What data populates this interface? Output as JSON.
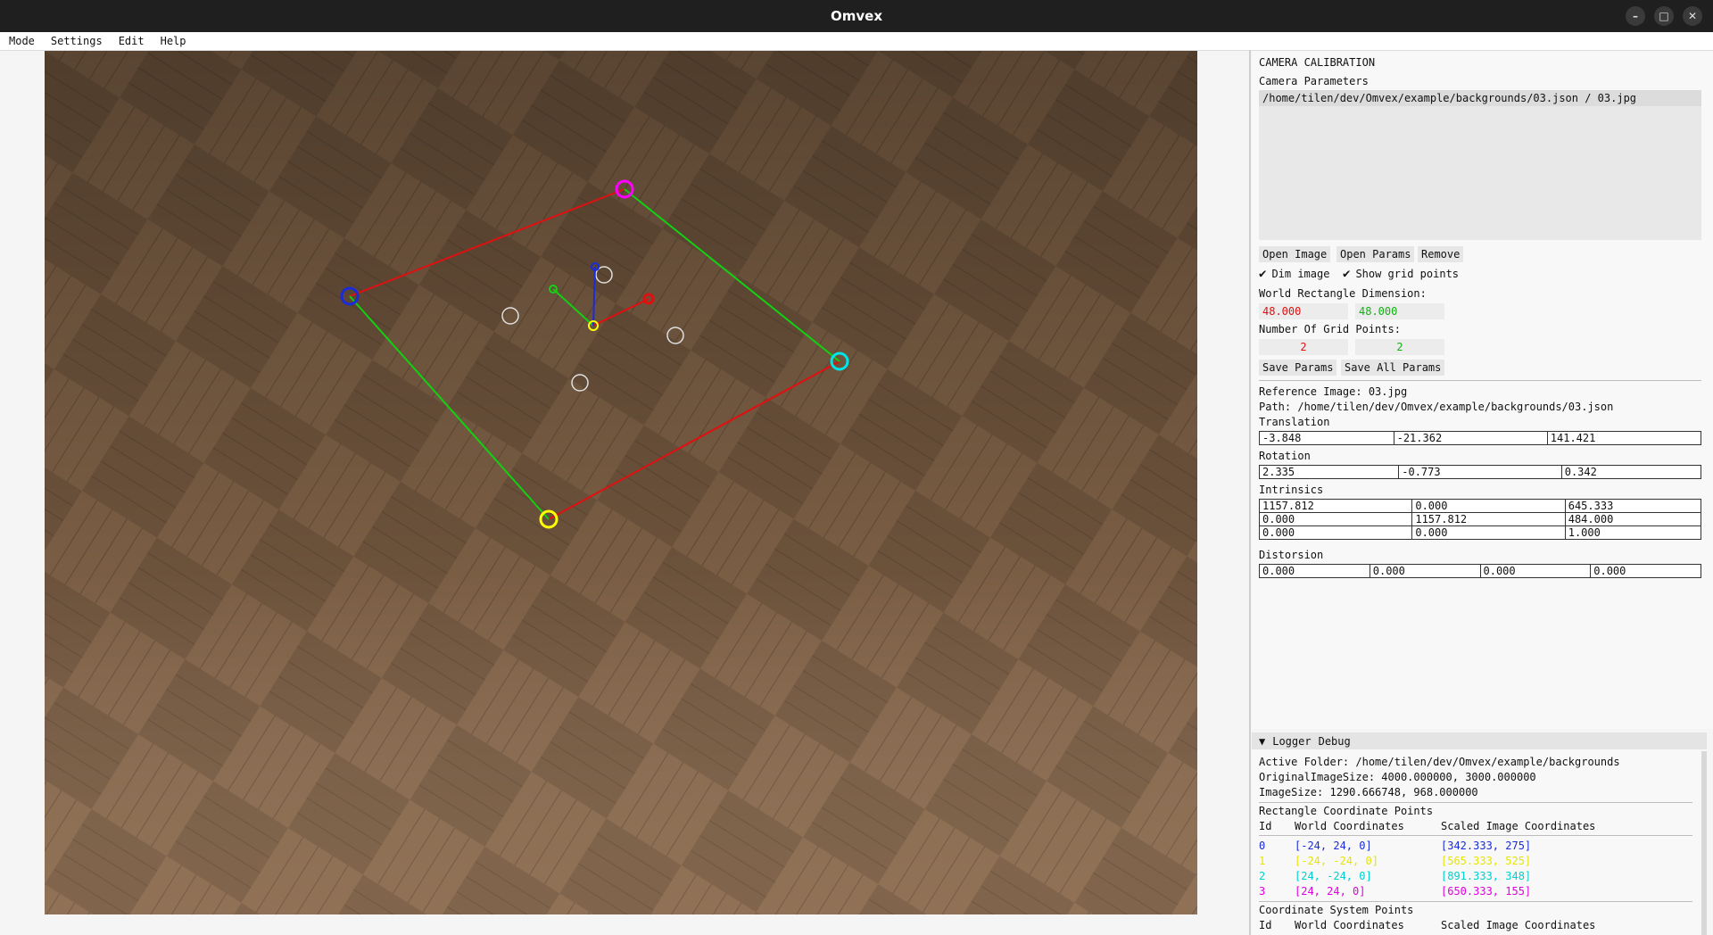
{
  "window": {
    "title": "Omvex",
    "controls": [
      "minimize-icon",
      "maximize-icon",
      "close-icon"
    ]
  },
  "menu": [
    "Mode",
    "Settings",
    "Edit",
    "Help"
  ],
  "viewport": {
    "image": "parquet floor photo",
    "colors": {
      "point0": "#1a2bd8",
      "point1": "#ffff00",
      "point2": "#00e5e5",
      "point3": "#ff00ff",
      "axis_x": "#e01010",
      "axis_y": "#12d012",
      "axis_z": "#1a2bd8"
    }
  },
  "panel": {
    "title": "CAMERA CALIBRATION",
    "camera_params_label": "Camera Parameters",
    "list_item": "/home/tilen/dev/Omvex/example/backgrounds/03.json / 03.jpg",
    "buttons": {
      "open_image": "Open Image",
      "open_params": "Open Params",
      "remove": "Remove",
      "save_params": "Save Params",
      "save_all_params": "Save All Params"
    },
    "checkboxes": {
      "dim_image": "Dim image",
      "show_grid_points": "Show grid points"
    },
    "world_rect_label": "World Rectangle Dimension:",
    "world_rect": [
      "48.000",
      "48.000"
    ],
    "grid_points_label": "Number Of Grid Points:",
    "grid_points": [
      "2",
      "2"
    ],
    "reference_image": "Reference Image: 03.jpg",
    "path": "Path: /home/tilen/dev/Omvex/example/backgrounds/03.json",
    "translation_label": "Translation",
    "translation": [
      "-3.848",
      "-21.362",
      "141.421"
    ],
    "rotation_label": "Rotation",
    "rotation": [
      "2.335",
      "-0.773",
      "0.342"
    ],
    "intrinsics_label": "Intrinsics",
    "intrinsics": [
      [
        "1157.812",
        "0.000",
        "645.333"
      ],
      [
        "0.000",
        "1157.812",
        "484.000"
      ],
      [
        "0.000",
        "0.000",
        "1.000"
      ]
    ],
    "distortion_label": "Distorsion",
    "distortion": [
      "0.000",
      "0.000",
      "0.000",
      "0.000"
    ]
  },
  "logger": {
    "tabs": [
      "Logger",
      "Debug"
    ],
    "active_folder": "Active Folder: /home/tilen/dev/Omvex/example/backgrounds",
    "original_size": "OriginalImageSize: 4000.000000, 3000.000000",
    "image_size": "ImageSize: 1290.666748, 968.000000",
    "rect_points_title": "Rectangle Coordinate Points",
    "headers": [
      "Id",
      "World Coordinates",
      "Scaled Image Coordinates"
    ],
    "rows": [
      {
        "id": "0",
        "world": "[-24, 24, 0]",
        "image": "[342.333, 275]",
        "color": "#1a2bd8"
      },
      {
        "id": "1",
        "world": "[-24, -24, 0]",
        "image": "[565.333, 525]",
        "color": "#e6e600"
      },
      {
        "id": "2",
        "world": "[24, -24, 0]",
        "image": "[891.333, 348]",
        "color": "#00d0d0"
      },
      {
        "id": "3",
        "world": "[24, 24, 0]",
        "image": "[650.333, 155]",
        "color": "#e000e0"
      }
    ],
    "coord_points_title": "Coordinate System Points",
    "headers2": [
      "Id",
      "World Coordinates",
      "Scaled Image Coordinates"
    ]
  }
}
